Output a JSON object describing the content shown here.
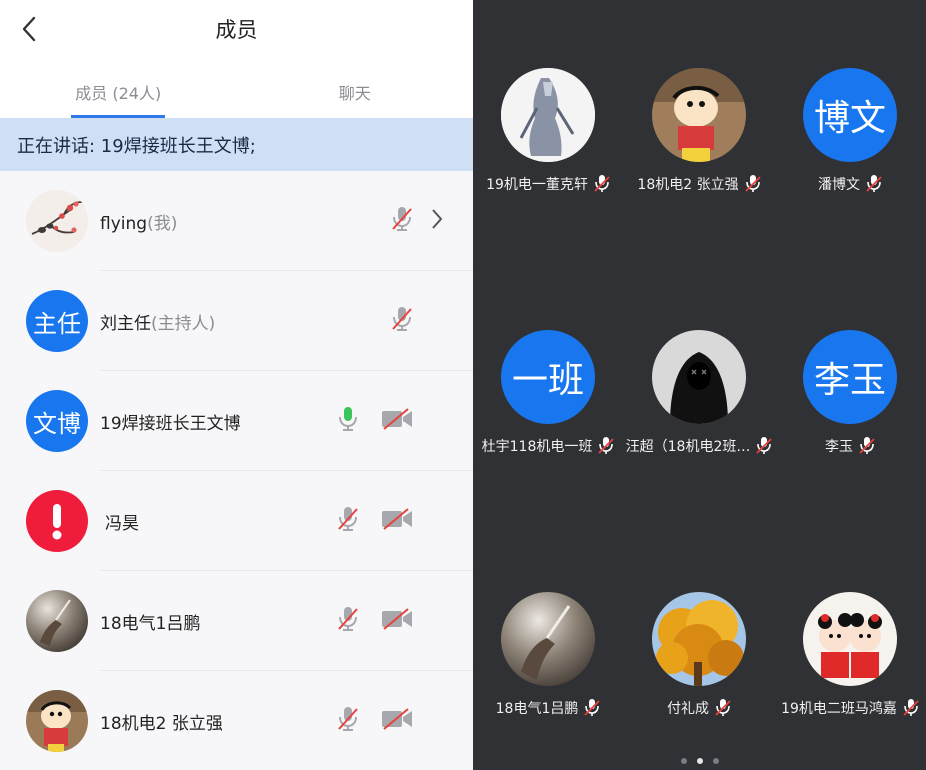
{
  "header": {
    "title": "成员"
  },
  "tabs": [
    {
      "label": "成员 (24人)",
      "active": true
    },
    {
      "label": "聊天",
      "active": false
    }
  ],
  "speaking": "正在讲话: 19焊接班长王文博;",
  "members": [
    {
      "name": "flying",
      "suffix": "(我)",
      "avatar": "plum-blossom-image",
      "mic": "muted",
      "camera": "none",
      "chevron": true
    },
    {
      "name": "刘主任",
      "suffix": "(主持人)",
      "avatar_text": "主任",
      "avatar_color": "#1877ef",
      "mic": "muted",
      "camera": "none"
    },
    {
      "name": "19焊接班长王文博",
      "suffix": "",
      "avatar_text": "文博",
      "avatar_color": "#1877ef",
      "mic": "active",
      "camera": "off"
    },
    {
      "name": "冯昊",
      "suffix": "",
      "avatar": "exclamation-icon",
      "avatar_color": "#ef1d3b",
      "mic": "muted",
      "camera": "off"
    },
    {
      "name": "18电气1吕鹏",
      "suffix": "",
      "avatar": "hand-photo-image",
      "mic": "muted",
      "camera": "off"
    },
    {
      "name": "18机电2 张立强",
      "suffix": "",
      "avatar": "cartoon-boy-image",
      "mic": "muted",
      "camera": "off"
    }
  ],
  "grid": [
    {
      "label": "19机电一董克轩",
      "avatar": "warrior-art-image"
    },
    {
      "label": "18机电2 张立强",
      "avatar": "cartoon-boy-image"
    },
    {
      "label": "潘博文",
      "avatar_text": "博文"
    },
    {
      "label": "杜宇118机电一班",
      "avatar_text": "一班"
    },
    {
      "label": "汪超（18机电2班…",
      "avatar": "dark-hoodie-image"
    },
    {
      "label": "李玉",
      "avatar_text": "李玉"
    },
    {
      "label": "18电气1吕鹏",
      "avatar": "hand-photo-image"
    },
    {
      "label": "付礼成",
      "avatar": "autumn-tree-image"
    },
    {
      "label": "19机电二班马鸿嘉",
      "avatar": "cartoon-kids-image"
    }
  ],
  "colors": {
    "accent": "#2f79e8",
    "speaking_bg": "#cfe0f6",
    "mic_active": "#3bc45a",
    "mute_red": "#e8413c",
    "dark_bg": "#303134"
  },
  "pager": {
    "pages": 3,
    "current": 2
  }
}
